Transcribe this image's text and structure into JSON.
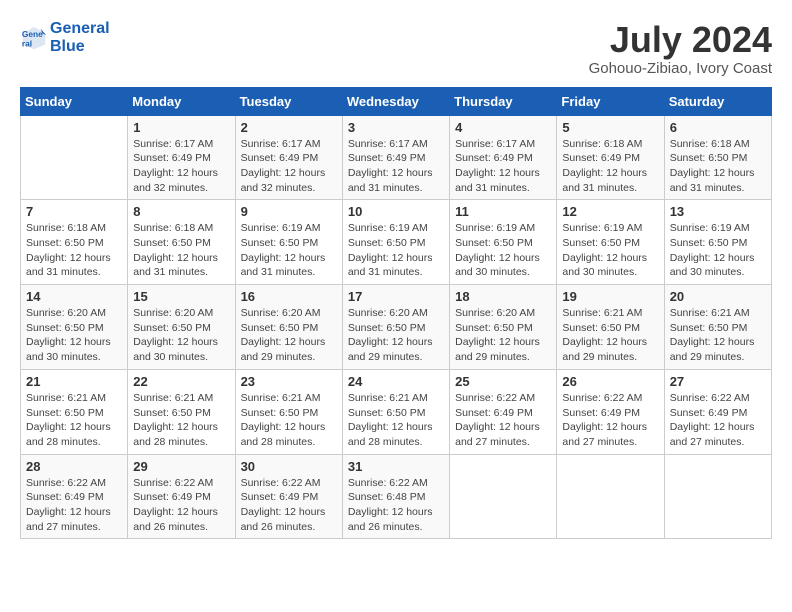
{
  "header": {
    "logo_line1": "General",
    "logo_line2": "Blue",
    "month": "July 2024",
    "location": "Gohouo-Zibiao, Ivory Coast"
  },
  "weekdays": [
    "Sunday",
    "Monday",
    "Tuesday",
    "Wednesday",
    "Thursday",
    "Friday",
    "Saturday"
  ],
  "weeks": [
    [
      {
        "day": "",
        "info": ""
      },
      {
        "day": "1",
        "info": "Sunrise: 6:17 AM\nSunset: 6:49 PM\nDaylight: 12 hours\nand 32 minutes."
      },
      {
        "day": "2",
        "info": "Sunrise: 6:17 AM\nSunset: 6:49 PM\nDaylight: 12 hours\nand 32 minutes."
      },
      {
        "day": "3",
        "info": "Sunrise: 6:17 AM\nSunset: 6:49 PM\nDaylight: 12 hours\nand 31 minutes."
      },
      {
        "day": "4",
        "info": "Sunrise: 6:17 AM\nSunset: 6:49 PM\nDaylight: 12 hours\nand 31 minutes."
      },
      {
        "day": "5",
        "info": "Sunrise: 6:18 AM\nSunset: 6:49 PM\nDaylight: 12 hours\nand 31 minutes."
      },
      {
        "day": "6",
        "info": "Sunrise: 6:18 AM\nSunset: 6:50 PM\nDaylight: 12 hours\nand 31 minutes."
      }
    ],
    [
      {
        "day": "7",
        "info": "Sunrise: 6:18 AM\nSunset: 6:50 PM\nDaylight: 12 hours\nand 31 minutes."
      },
      {
        "day": "8",
        "info": "Sunrise: 6:18 AM\nSunset: 6:50 PM\nDaylight: 12 hours\nand 31 minutes."
      },
      {
        "day": "9",
        "info": "Sunrise: 6:19 AM\nSunset: 6:50 PM\nDaylight: 12 hours\nand 31 minutes."
      },
      {
        "day": "10",
        "info": "Sunrise: 6:19 AM\nSunset: 6:50 PM\nDaylight: 12 hours\nand 31 minutes."
      },
      {
        "day": "11",
        "info": "Sunrise: 6:19 AM\nSunset: 6:50 PM\nDaylight: 12 hours\nand 30 minutes."
      },
      {
        "day": "12",
        "info": "Sunrise: 6:19 AM\nSunset: 6:50 PM\nDaylight: 12 hours\nand 30 minutes."
      },
      {
        "day": "13",
        "info": "Sunrise: 6:19 AM\nSunset: 6:50 PM\nDaylight: 12 hours\nand 30 minutes."
      }
    ],
    [
      {
        "day": "14",
        "info": "Sunrise: 6:20 AM\nSunset: 6:50 PM\nDaylight: 12 hours\nand 30 minutes."
      },
      {
        "day": "15",
        "info": "Sunrise: 6:20 AM\nSunset: 6:50 PM\nDaylight: 12 hours\nand 30 minutes."
      },
      {
        "day": "16",
        "info": "Sunrise: 6:20 AM\nSunset: 6:50 PM\nDaylight: 12 hours\nand 29 minutes."
      },
      {
        "day": "17",
        "info": "Sunrise: 6:20 AM\nSunset: 6:50 PM\nDaylight: 12 hours\nand 29 minutes."
      },
      {
        "day": "18",
        "info": "Sunrise: 6:20 AM\nSunset: 6:50 PM\nDaylight: 12 hours\nand 29 minutes."
      },
      {
        "day": "19",
        "info": "Sunrise: 6:21 AM\nSunset: 6:50 PM\nDaylight: 12 hours\nand 29 minutes."
      },
      {
        "day": "20",
        "info": "Sunrise: 6:21 AM\nSunset: 6:50 PM\nDaylight: 12 hours\nand 29 minutes."
      }
    ],
    [
      {
        "day": "21",
        "info": "Sunrise: 6:21 AM\nSunset: 6:50 PM\nDaylight: 12 hours\nand 28 minutes."
      },
      {
        "day": "22",
        "info": "Sunrise: 6:21 AM\nSunset: 6:50 PM\nDaylight: 12 hours\nand 28 minutes."
      },
      {
        "day": "23",
        "info": "Sunrise: 6:21 AM\nSunset: 6:50 PM\nDaylight: 12 hours\nand 28 minutes."
      },
      {
        "day": "24",
        "info": "Sunrise: 6:21 AM\nSunset: 6:50 PM\nDaylight: 12 hours\nand 28 minutes."
      },
      {
        "day": "25",
        "info": "Sunrise: 6:22 AM\nSunset: 6:49 PM\nDaylight: 12 hours\nand 27 minutes."
      },
      {
        "day": "26",
        "info": "Sunrise: 6:22 AM\nSunset: 6:49 PM\nDaylight: 12 hours\nand 27 minutes."
      },
      {
        "day": "27",
        "info": "Sunrise: 6:22 AM\nSunset: 6:49 PM\nDaylight: 12 hours\nand 27 minutes."
      }
    ],
    [
      {
        "day": "28",
        "info": "Sunrise: 6:22 AM\nSunset: 6:49 PM\nDaylight: 12 hours\nand 27 minutes."
      },
      {
        "day": "29",
        "info": "Sunrise: 6:22 AM\nSunset: 6:49 PM\nDaylight: 12 hours\nand 26 minutes."
      },
      {
        "day": "30",
        "info": "Sunrise: 6:22 AM\nSunset: 6:49 PM\nDaylight: 12 hours\nand 26 minutes."
      },
      {
        "day": "31",
        "info": "Sunrise: 6:22 AM\nSunset: 6:48 PM\nDaylight: 12 hours\nand 26 minutes."
      },
      {
        "day": "",
        "info": ""
      },
      {
        "day": "",
        "info": ""
      },
      {
        "day": "",
        "info": ""
      }
    ]
  ]
}
